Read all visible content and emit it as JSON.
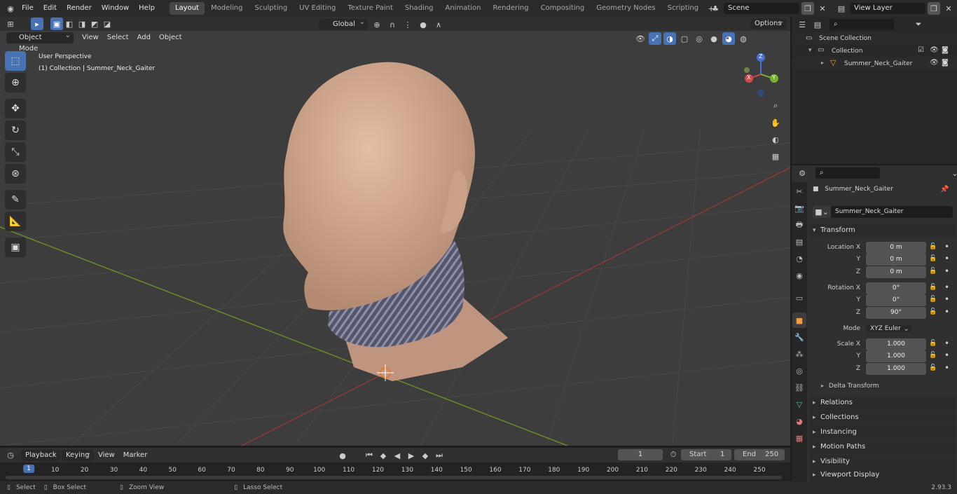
{
  "menu": [
    "File",
    "Edit",
    "Render",
    "Window",
    "Help"
  ],
  "workspaces": [
    "Layout",
    "Modeling",
    "Sculpting",
    "UV Editing",
    "Texture Paint",
    "Shading",
    "Animation",
    "Rendering",
    "Compositing",
    "Geometry Nodes",
    "Scripting"
  ],
  "active_workspace": "Layout",
  "scene_name": "Scene",
  "view_layer": "View Layer",
  "viewport": {
    "mode": "Object Mode",
    "menus": [
      "View",
      "Select",
      "Add",
      "Object"
    ],
    "transform_orientation": "Global",
    "options_label": "Options",
    "overlay_title": "User Perspective",
    "overlay_subtitle": "(1) Collection | Summer_Neck_Gaiter",
    "gizmo_axes": {
      "x": "X",
      "y": "Y",
      "z": "Z"
    }
  },
  "outliner": {
    "root": "Scene Collection",
    "collection": "Collection",
    "object": "Summer_Neck_Gaiter"
  },
  "properties": {
    "object_name": "Summer_Neck_Gaiter",
    "datablock_name": "Summer_Neck_Gaiter",
    "transform_label": "Transform",
    "location": {
      "label_x": "Location X",
      "x": "0 m",
      "y": "0 m",
      "z": "0 m"
    },
    "rotation": {
      "label_x": "Rotation X",
      "x": "0°",
      "y": "0°",
      "z": "90°"
    },
    "mode_label": "Mode",
    "mode_value": "XYZ Euler",
    "scale": {
      "label_x": "Scale X",
      "x": "1.000",
      "y": "1.000",
      "z": "1.000"
    },
    "axis_y": "Y",
    "axis_z": "Z",
    "delta_transform": "Delta Transform",
    "panels": [
      "Relations",
      "Collections",
      "Instancing",
      "Motion Paths",
      "Visibility",
      "Viewport Display"
    ]
  },
  "timeline": {
    "menus": [
      "Playback",
      "Keying",
      "View",
      "Marker"
    ],
    "current_frame": "1",
    "start_label": "Start",
    "start": "1",
    "end_label": "End",
    "end": "250",
    "ticks": [
      "1",
      "10",
      "20",
      "30",
      "40",
      "50",
      "60",
      "70",
      "80",
      "90",
      "100",
      "110",
      "120",
      "130",
      "140",
      "150",
      "160",
      "170",
      "180",
      "190",
      "200",
      "210",
      "220",
      "230",
      "240",
      "250"
    ]
  },
  "statusbar": {
    "select": "Select",
    "box_select": "Box Select",
    "zoom_view": "Zoom View",
    "lasso_select": "Lasso Select",
    "version": "2.93.3"
  }
}
